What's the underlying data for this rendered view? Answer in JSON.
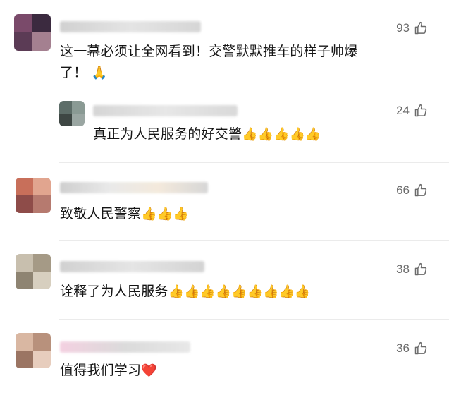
{
  "comments": [
    {
      "text_line1": "这一幕必须让全网看到！交警默默推车的样子帅爆",
      "text_line2": "了！",
      "emoji": "🙏",
      "likes": "93"
    },
    {
      "text": "真正为人民服务的好交警",
      "emoji": "👍👍👍👍👍",
      "likes": "24"
    },
    {
      "text": "致敬人民警察",
      "emoji": "👍👍👍",
      "likes": "66"
    },
    {
      "text": "诠释了为人民服务",
      "emoji": "👍👍👍👍👍👍👍👍👍",
      "likes": "38"
    },
    {
      "text": "值得我们学习",
      "emoji": "❤️",
      "likes": "36"
    }
  ],
  "icons": {
    "like": "thumb-up-icon"
  },
  "colors": {
    "count": "#6b6b6b",
    "divider": "#ebebeb"
  }
}
